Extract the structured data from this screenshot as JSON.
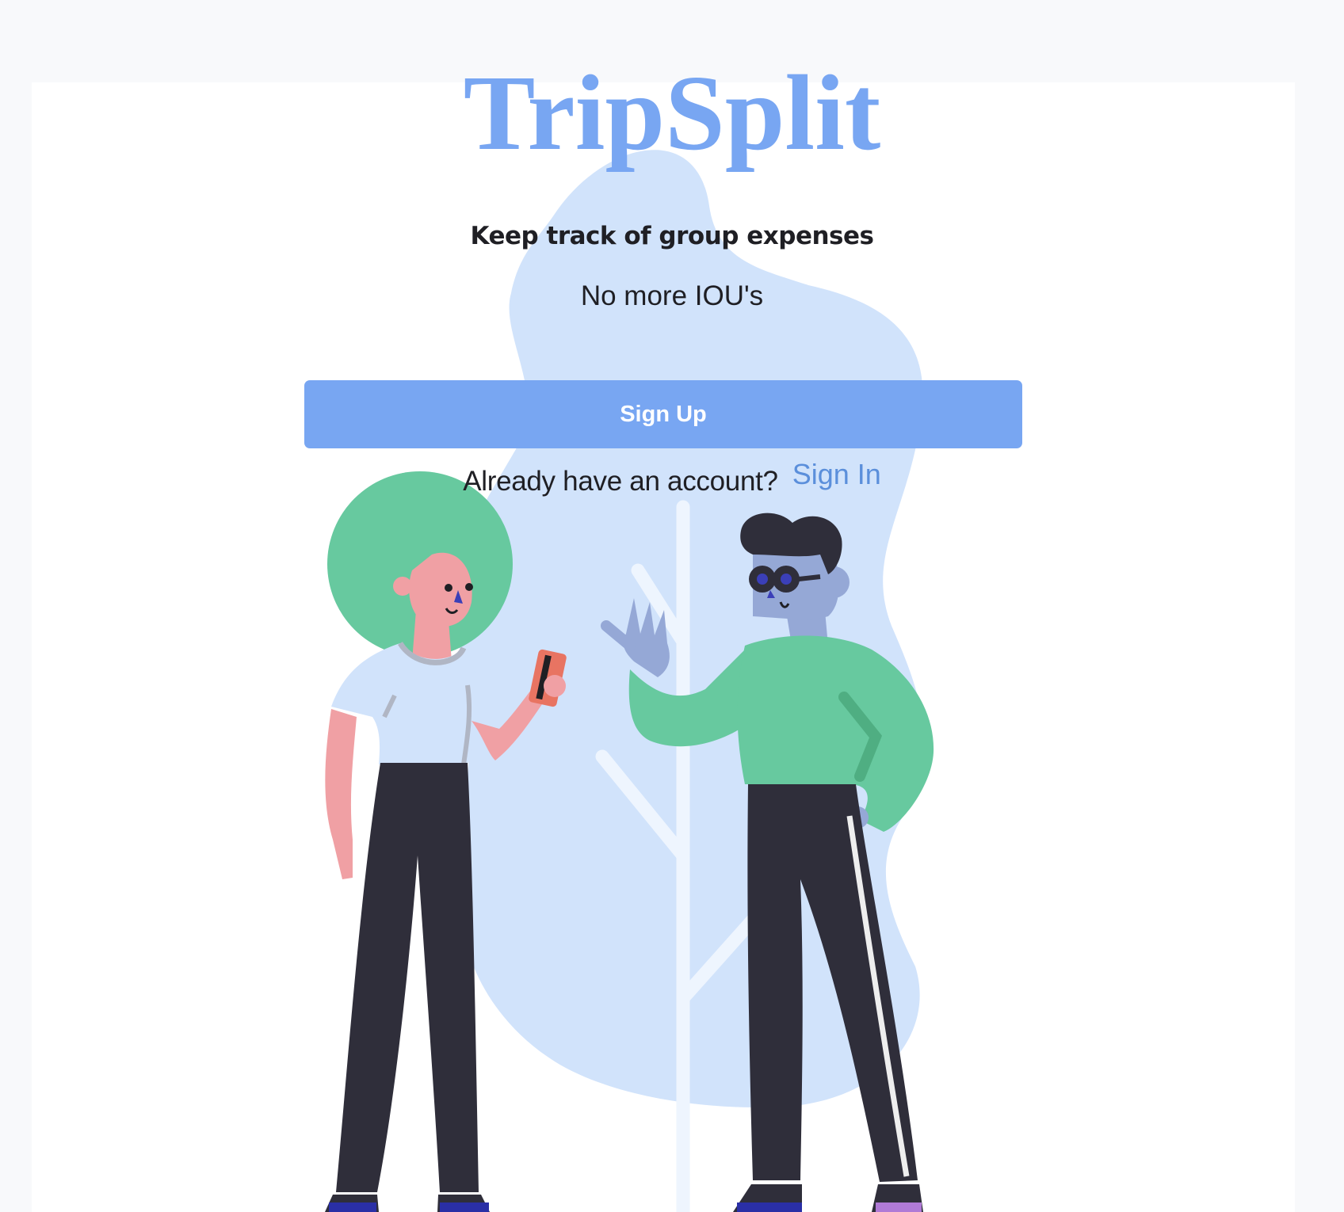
{
  "app": {
    "title": "TripSplit"
  },
  "hero": {
    "tagline": "Keep track of group expenses",
    "subtitle": "No more IOU's"
  },
  "actions": {
    "signup_label": "Sign Up",
    "signin_prompt": "Already have an account?",
    "signin_label": "Sign In"
  },
  "theme": {
    "accent": "#78a6f2",
    "link": "#5b8fdb",
    "blob": "#d1e3fb",
    "green": "#67c99f",
    "dark": "#2f2e3a",
    "skin_woman": "#f0a0a4",
    "skin_man": "#95a8d6"
  },
  "illustration": {
    "name": "two-people-illustration"
  }
}
